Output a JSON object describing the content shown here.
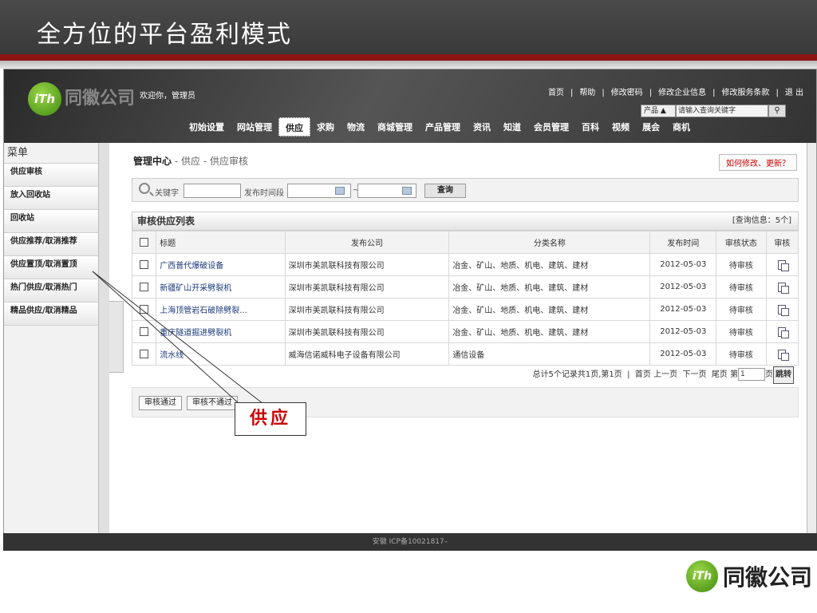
{
  "slide": {
    "title": "全方位的平台盈利模式"
  },
  "header": {
    "logo_mark": "iTh",
    "logo_text": "同徽公司",
    "welcome": "欢迎你，管理员",
    "top_links": [
      "首页",
      "|",
      "帮助",
      "|",
      "修改密码",
      "|",
      "修改企业信息",
      "|",
      "修改服务条款",
      "|",
      "退 出"
    ],
    "search": {
      "category": "产品 ▲",
      "placeholder": "请输入查询关键字",
      "button_icon": "search-icon"
    },
    "nav": [
      "初始设置",
      "网站管理",
      "供应",
      "求购",
      "物流",
      "商城管理",
      "产品管理",
      "资讯",
      "知道",
      "会员管理",
      "百科",
      "视频",
      "展会",
      "商机"
    ],
    "nav_active": "供应"
  },
  "sidebar": {
    "title": "菜单",
    "items": [
      "供应审核",
      "放入回收站",
      "回收站",
      "供应推荐/取消推荐",
      "供应置顶/取消置顶",
      "热门供应/取消热门",
      "精品供应/取消精品"
    ]
  },
  "main": {
    "breadcrumb": {
      "root": "管理中心",
      "sep1": " - ",
      "level1": "供应",
      "sep2": " - ",
      "level2": "供应审核"
    },
    "help_button": "如何修改、更新？",
    "filter": {
      "keyword_label": "关键字",
      "date_label": "发布时间段",
      "tilde": "~",
      "query_button": "查询"
    },
    "list": {
      "title": "审核供应列表",
      "info": "[查询信息：5个]",
      "columns": [
        "标题",
        "发布公司",
        "分类名称",
        "发布时间",
        "审核状态",
        "审核"
      ],
      "rows": [
        {
          "title": "广西普代爆破设备",
          "company": "深圳市美凯联科技有限公司",
          "category": "冶金、矿山、地质、机电、建筑、建材",
          "date": "2012-05-03",
          "status": "待审核"
        },
        {
          "title": "新疆矿山开采劈裂机",
          "company": "深圳市美凯联科技有限公司",
          "category": "冶金、矿山、地质、机电、建筑、建材",
          "date": "2012-05-03",
          "status": "待审核"
        },
        {
          "title": "上海顶管岩石破除劈裂...",
          "company": "深圳市美凯联科技有限公司",
          "category": "冶金、矿山、地质、机电、建筑、建材",
          "date": "2012-05-03",
          "status": "待审核"
        },
        {
          "title": "重庆隧道掘进劈裂机",
          "company": "深圳市美凯联科技有限公司",
          "category": "冶金、矿山、地质、机电、建筑、建材",
          "date": "2012-05-03",
          "status": "待审核"
        },
        {
          "title": "流水线",
          "company": "威海信诺威科电子设备有限公司",
          "category": "通信设备",
          "date": "2012-05-03",
          "status": "待审核"
        }
      ]
    },
    "pager": {
      "summary": "总计5个记录共1页,第1页",
      "first": "首页",
      "prev": "上一页",
      "next": "下一页",
      "last": "尾页",
      "page_prefix": "第",
      "page_value": "1",
      "page_suffix": "页",
      "go": "跳转"
    },
    "actions": {
      "approve": "审核通过",
      "reject": "审核不通过"
    }
  },
  "footer": {
    "icp": "安徽 ICP备10021817–"
  },
  "callout": {
    "text": "供应"
  },
  "brand": {
    "mark": "iTh",
    "name": "同徽公司"
  }
}
